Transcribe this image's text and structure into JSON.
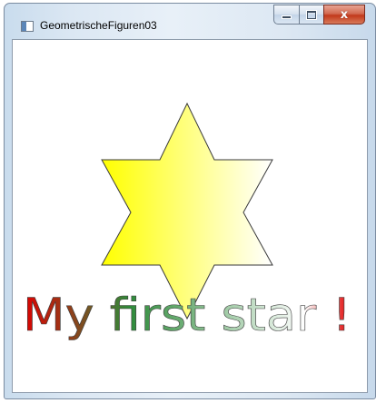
{
  "window": {
    "title": "GeometrischeFiguren03",
    "close_symbol": "x"
  },
  "icons": {
    "app": "window-app-icon",
    "minimize": "minimize-icon",
    "maximize": "maximize-icon",
    "close": "close-icon"
  },
  "canvas": {
    "headline": "My first star !",
    "star_gradient": [
      "#ffff00",
      "#ffffff"
    ],
    "text_gradient": [
      "#e00000",
      "#2e8b3a",
      "#ffffff",
      "#e00000"
    ]
  }
}
